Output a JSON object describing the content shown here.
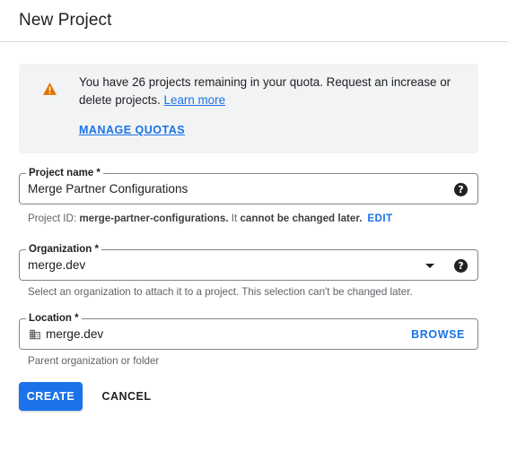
{
  "header": {
    "title": "New Project"
  },
  "quota": {
    "message": "You have 26 projects remaining in your quota. Request an increase or delete projects.",
    "learn_more": "Learn more",
    "manage_quotas": "MANAGE QUOTAS",
    "icon": "warning-icon",
    "icon_color": "#e37400"
  },
  "project_name": {
    "label": "Project name *",
    "value": "Merge Partner Configurations",
    "hint_prefix": "Project ID:",
    "project_id": "merge-partner-configurations.",
    "hint_middle": "It",
    "hint_emphasis": "cannot be changed later.",
    "edit_label": "EDIT"
  },
  "organization": {
    "label": "Organization *",
    "value": "merge.dev",
    "hint": "Select an organization to attach it to a project. This selection can't be changed later."
  },
  "location": {
    "label": "Location *",
    "value": "merge.dev",
    "browse_label": "BROWSE",
    "hint": "Parent organization or folder",
    "icon": "building-icon"
  },
  "actions": {
    "create_label": "CREATE",
    "cancel_label": "CANCEL"
  },
  "colors": {
    "accent": "#1a73e8",
    "text": "#202124",
    "hint": "#5f6368",
    "banner_bg": "#f1f3f4"
  }
}
